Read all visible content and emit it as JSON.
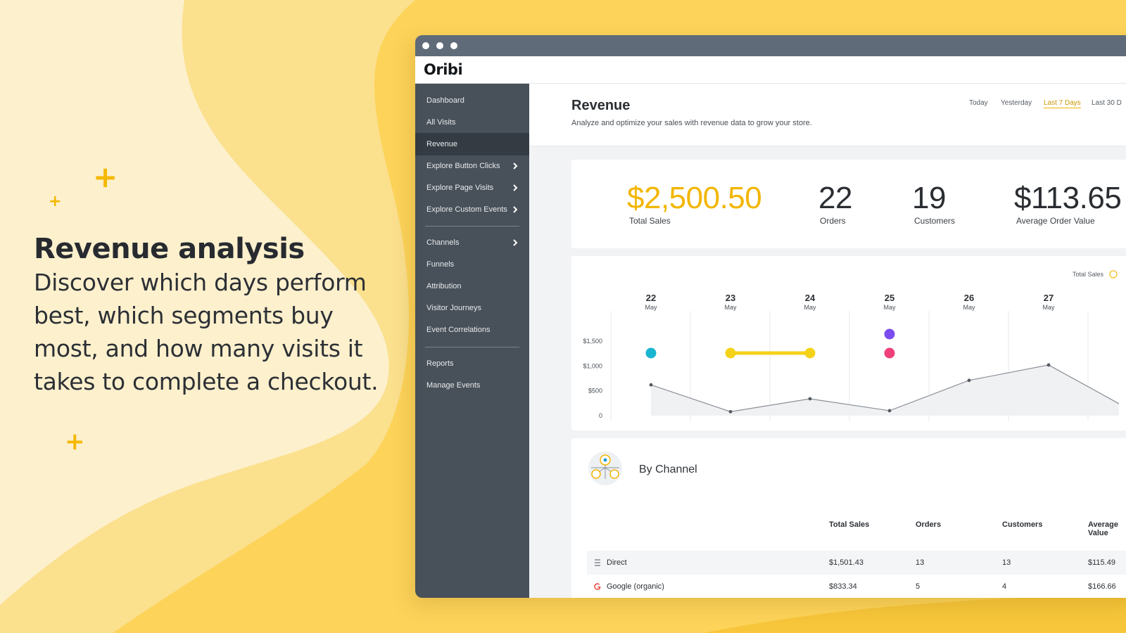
{
  "hero": {
    "title": "Revenue analysis",
    "subtitle_lines": [
      "Discover which days perform",
      "best, which segments buy",
      "most, and how many visits it",
      "takes to complete a checkout."
    ]
  },
  "decor": {
    "plus_symbol": "+"
  },
  "app": {
    "logo": "Oribi",
    "sidebar": {
      "items": [
        {
          "label": "Dashboard"
        },
        {
          "label": "All Visits"
        },
        {
          "label": "Revenue",
          "active": true
        },
        {
          "label": "Explore Button Clicks",
          "has_submenu": true
        },
        {
          "label": "Explore Page Visits",
          "has_submenu": true
        },
        {
          "label": "Explore Custom Events",
          "has_submenu": true
        },
        {
          "label": "Channels",
          "has_submenu": true
        },
        {
          "label": "Funnels"
        },
        {
          "label": "Attribution"
        },
        {
          "label": "Visitor Journeys"
        },
        {
          "label": "Event Correlations"
        },
        {
          "label": "Reports"
        },
        {
          "label": "Manage Events"
        }
      ]
    },
    "header": {
      "title": "Revenue",
      "description": "Analyze and optimize your sales with revenue data to grow your store.",
      "ranges": [
        "Today",
        "Yesterday",
        "Last 7 Days",
        "Last 30 D"
      ],
      "selected_range": "Last 7 Days"
    },
    "stats": [
      {
        "value": "$2,500.50",
        "label": "Total Sales"
      },
      {
        "value": "22",
        "label": "Orders"
      },
      {
        "value": "19",
        "label": "Customers"
      },
      {
        "value": "$113.65",
        "label": "Average Order Value"
      }
    ],
    "channel_section": {
      "title": "By Channel",
      "columns": [
        "Total Sales",
        "Orders",
        "Customers",
        "Average Value"
      ],
      "rows": [
        {
          "icon": "list-icon",
          "name": "Direct",
          "total_sales": "$1,501.43",
          "orders": "13",
          "customers": "13",
          "avg": "$115.49"
        },
        {
          "icon": "google-icon",
          "name": "Google (organic)",
          "total_sales": "$833.34",
          "orders": "5",
          "customers": "4",
          "avg": "$166.66"
        }
      ]
    },
    "colors": {
      "accent": "#f5b800",
      "sidebar": "#485059",
      "titlebar": "#5f6b78",
      "cyan_marker": "#19b5d0",
      "purple_marker": "#7a4cf0",
      "pink_marker": "#f0407a"
    }
  },
  "chart_data": {
    "type": "line",
    "legend": [
      "Total Sales"
    ],
    "legend_position": "top-right",
    "days": [
      {
        "day": "22",
        "month": "May"
      },
      {
        "day": "23",
        "month": "May"
      },
      {
        "day": "24",
        "month": "May"
      },
      {
        "day": "25",
        "month": "May"
      },
      {
        "day": "26",
        "month": "May"
      },
      {
        "day": "27",
        "month": "May"
      }
    ],
    "series": [
      {
        "name": "Total Sales",
        "values": [
          620,
          80,
          340,
          100,
          710,
          1020
        ]
      }
    ],
    "yticks": [
      "$1,500",
      "$1,000",
      "$500",
      "0"
    ],
    "ytick_values": [
      1500,
      1000,
      500,
      0
    ],
    "ylim": [
      0,
      1500
    ],
    "grid": true
  }
}
